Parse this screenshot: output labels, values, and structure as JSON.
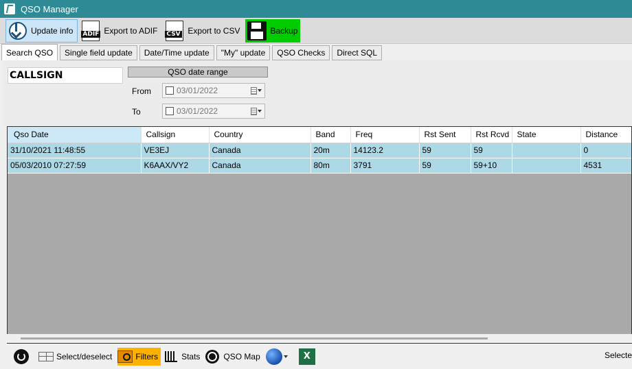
{
  "window": {
    "title": "QSO Manager"
  },
  "toolbar": {
    "update_info": "Update info",
    "export_adif": "Export to ADIF",
    "export_csv": "Export to CSV",
    "backup": "Backup",
    "adif_tag": "ADIF",
    "csv_tag": "CSV"
  },
  "tabs": [
    "Search QSO",
    "Single field update",
    "Date/Time update",
    "\"My\" update",
    "QSO Checks",
    "Direct SQL"
  ],
  "search": {
    "callsign": "CALLSIGN",
    "range_header": "QSO date range",
    "from_label": "From",
    "to_label": "To",
    "from_value": "03/01/2022",
    "to_value": "03/01/2022"
  },
  "grid": {
    "columns": [
      "Qso Date",
      "Callsign",
      "Country",
      "Band",
      "Freq",
      "Rst Sent",
      "Rst Rcvd",
      "State",
      "Distance"
    ],
    "rows": [
      [
        "31/10/2021 11:48:55",
        "VE3EJ",
        "Canada",
        "20m",
        "14123.2",
        "59",
        "59",
        "",
        "0"
      ],
      [
        "05/03/2010 07:27:59",
        "K6AAX/VY2",
        "Canada",
        "80m",
        "3791",
        "59",
        "59+10",
        "",
        "4531"
      ]
    ]
  },
  "statusbar": {
    "select": "Select/deselect",
    "filters": "Filters",
    "stats": "Stats",
    "map": "QSO Map",
    "selected": "Selected"
  },
  "colors": {
    "titlebar": "#2e8b96",
    "row_bg": "#add8e6",
    "filters_bg": "#ffb100",
    "backup_bg": "#00cc00"
  }
}
